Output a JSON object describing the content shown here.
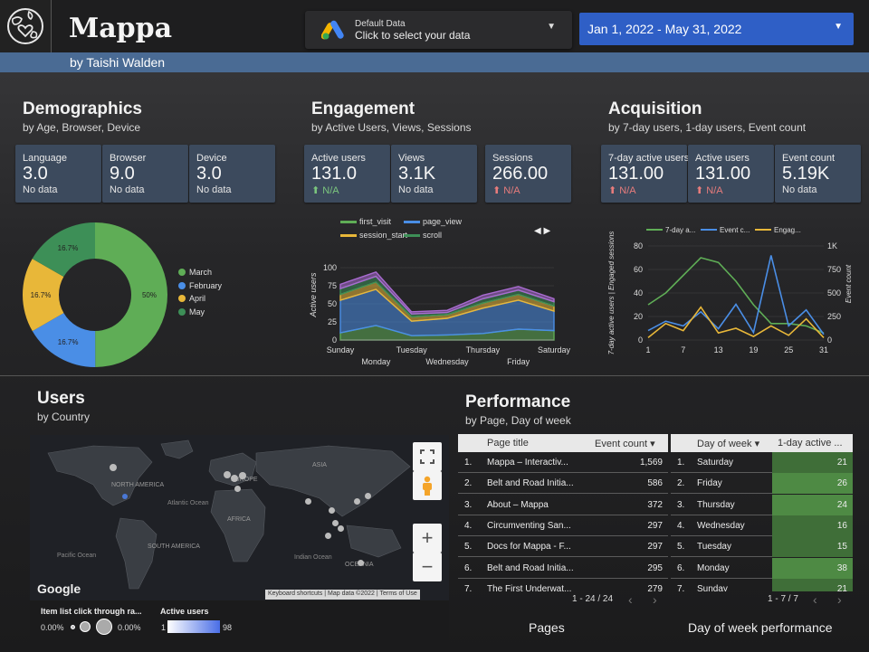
{
  "header": {
    "app_title": "Mappa",
    "byline": "by Taishi Walden",
    "datasource_title": "Default Data",
    "datasource_subtitle": "Click to select your data",
    "date_range": "Jan 1, 2022 - May 31, 2022"
  },
  "demographics": {
    "title": "Demographics",
    "subtitle": "by Age, Browser, Device",
    "cards": [
      {
        "label": "Language",
        "value": "3.0",
        "sub": "No data"
      },
      {
        "label": "Browser",
        "value": "9.0",
        "sub": "No data"
      },
      {
        "label": "Device",
        "value": "3.0",
        "sub": "No data"
      }
    ]
  },
  "engagement": {
    "title": "Engagement",
    "subtitle": "by Active Users, Views, Sessions",
    "cards": [
      {
        "label": "Active users",
        "value": "131.0",
        "sub": "N/A",
        "arrow": "⬆"
      },
      {
        "label": "Views",
        "value": "3.1K",
        "sub": "No data"
      },
      {
        "label": "Sessions",
        "value": "266.00",
        "sub": "N/A",
        "arrow": "⬆"
      }
    ]
  },
  "acquisition": {
    "title": "Acquisition",
    "subtitle": "by 7-day users, 1-day users, Event count",
    "cards": [
      {
        "label": "7-day active users",
        "value": "131.00",
        "sub": "N/A",
        "arrow": "⬆"
      },
      {
        "label": "Active users",
        "value": "131.00",
        "sub": "N/A",
        "arrow": "⬆"
      },
      {
        "label": "Event count",
        "value": "5.19K",
        "sub": "No data"
      }
    ]
  },
  "chart_data": [
    {
      "type": "pie",
      "slices": [
        {
          "label": "March",
          "value": 50,
          "color": "#5fad56",
          "text": "50%"
        },
        {
          "label": "February",
          "value": 16.7,
          "color": "#4a8ee6",
          "text": "16.7%"
        },
        {
          "label": "April",
          "value": 16.7,
          "color": "#e8b739",
          "text": "16.7%"
        },
        {
          "label": "May",
          "value": 16.7,
          "color": "#3d8f57",
          "text": "16.7%"
        }
      ]
    },
    {
      "type": "area",
      "ylabel": "Active users",
      "categories": [
        "Sunday",
        "Monday",
        "Tuesday",
        "Wednesday",
        "Thursday",
        "Friday",
        "Saturday"
      ],
      "ylim": [
        0,
        125
      ],
      "yticks": [
        0,
        50,
        100
      ],
      "yticks_minor": [
        25,
        75
      ],
      "legend_page": "◀ ▶",
      "series": [
        {
          "name": "first_visit",
          "color": "#5fad56",
          "values": [
            10,
            20,
            6,
            7,
            9,
            15,
            13
          ]
        },
        {
          "name": "page_view",
          "color": "#4a8ee6",
          "values": [
            45,
            50,
            20,
            23,
            35,
            40,
            27
          ]
        },
        {
          "name": "session_start",
          "color": "#e8b739",
          "values": [
            8,
            10,
            6,
            5,
            7,
            8,
            7
          ]
        },
        {
          "name": "scroll",
          "color": "#3d8f57",
          "values": [
            8,
            8,
            4,
            3,
            6,
            6,
            6
          ]
        },
        {
          "name": "",
          "color": "#a96bd1",
          "values": [
            6,
            6,
            3,
            3,
            5,
            5,
            4
          ]
        }
      ]
    },
    {
      "type": "line",
      "ylabel": "7-day active users | Engaged sessions",
      "ylabel_right": "Event count",
      "x": [
        1,
        4,
        7,
        10,
        13,
        16,
        19,
        22,
        25,
        28,
        31
      ],
      "xticks": [
        1,
        7,
        13,
        19,
        25,
        31
      ],
      "ylim_left": [
        0,
        80
      ],
      "yticks_left": [
        0,
        20,
        40,
        60,
        80
      ],
      "ylim_right": [
        0,
        1000
      ],
      "yticks_right": [
        "0",
        "250",
        "500",
        "750",
        "1K"
      ],
      "series": [
        {
          "name": "7-day a...",
          "color": "#5fad56",
          "axis": "left",
          "values": [
            30,
            40,
            55,
            70,
            66,
            50,
            30,
            14,
            14,
            12,
            6
          ]
        },
        {
          "name": "Event c...",
          "color": "#4a8ee6",
          "axis": "right",
          "values": [
            100,
            200,
            150,
            300,
            120,
            380,
            80,
            900,
            150,
            320,
            60
          ]
        },
        {
          "name": "Engag...",
          "color": "#e8b739",
          "axis": "left",
          "values": [
            2,
            14,
            8,
            28,
            6,
            10,
            3,
            12,
            4,
            18,
            2
          ]
        }
      ]
    }
  ],
  "users": {
    "title": "Users",
    "subtitle": "by Country",
    "map_labels": [
      "NORTH AMERICA",
      "EUROPE",
      "ASIA",
      "AFRICA",
      "SOUTH AMERICA",
      "OCEANIA",
      "Atlantic Ocean",
      "Pacific Ocean",
      "Indian Ocean"
    ],
    "google": "Google",
    "attrib": [
      "Keyboard shortcuts",
      "Map data ©2022",
      "Terms of Use"
    ],
    "legend_size_title": "Item list click through ra...",
    "legend_size_min": "0.00%",
    "legend_size_max": "0.00%",
    "legend_color_title": "Active users",
    "legend_color_min": "1",
    "legend_color_max": "98"
  },
  "performance": {
    "title": "Performance",
    "subtitle": "by Page, Day of week",
    "pages_table": {
      "headers": [
        "Page title",
        "Event count ▾"
      ],
      "rows": [
        [
          "1.",
          "Mappa – Interactiv...",
          "1,569"
        ],
        [
          "2.",
          "Belt and Road Initia...",
          "586"
        ],
        [
          "3.",
          "About – Mappa",
          "372"
        ],
        [
          "4.",
          "Circumventing San...",
          "297"
        ],
        [
          "5.",
          "Docs for Mappa - F...",
          "297"
        ],
        [
          "6.",
          "Belt and Road Initia...",
          "295"
        ],
        [
          "7.",
          "The First Underwat...",
          "279"
        ]
      ],
      "pager": "1 - 24 / 24",
      "title": "Pages"
    },
    "dow_table": {
      "headers": [
        "Day of week ▾",
        "1-day active ..."
      ],
      "rows": [
        [
          "1.",
          "Saturday",
          "21"
        ],
        [
          "2.",
          "Friday",
          "26"
        ],
        [
          "3.",
          "Thursday",
          "24"
        ],
        [
          "4.",
          "Wednesday",
          "16"
        ],
        [
          "5.",
          "Tuesday",
          "15"
        ],
        [
          "6.",
          "Monday",
          "38"
        ],
        [
          "7.",
          "Sunday",
          "21"
        ]
      ],
      "pager": "1 - 7 / 7",
      "title": "Day of week performance"
    }
  }
}
